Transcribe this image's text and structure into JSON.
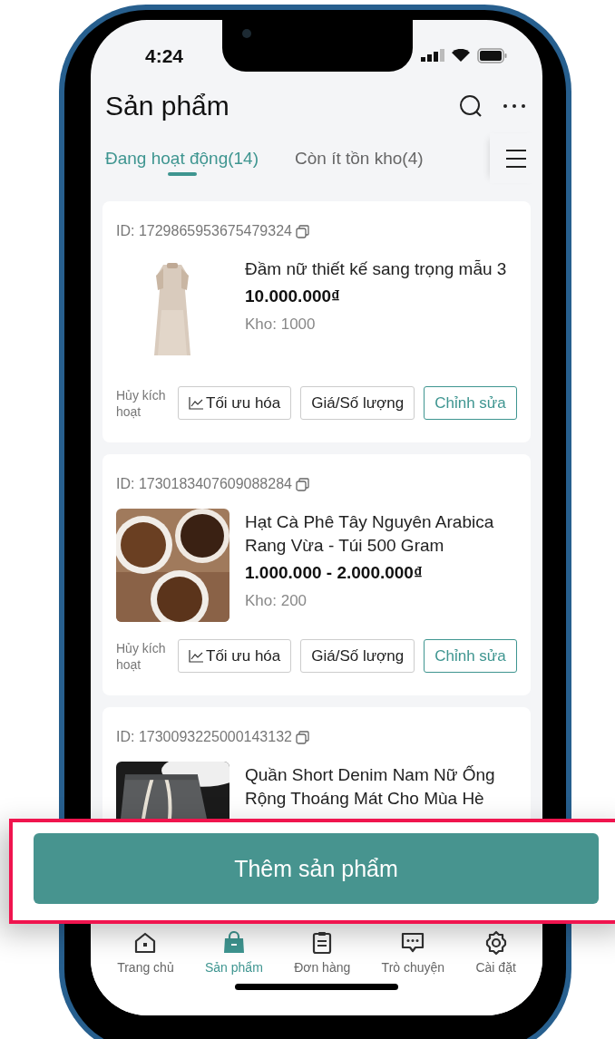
{
  "status_bar": {
    "time": "4:24"
  },
  "header": {
    "title": "Sản phẩm"
  },
  "tabs": [
    {
      "label": "Đang hoạt động(14)",
      "selected": true
    },
    {
      "label": "Còn ít tồn kho(4)",
      "selected": false
    }
  ],
  "products": [
    {
      "id": "ID: 1729865953675479324",
      "name": "Đầm nữ thiết kế sang trọng mẫu 3",
      "price": "10.000.000₫",
      "stock": "Kho: 1000",
      "deactivate": "Hủy kích hoạt",
      "actions": [
        {
          "label": "Tối ưu hóa",
          "kind": "icon"
        },
        {
          "label": "Giá/Số lượng",
          "kind": "plain"
        },
        {
          "label": "Chỉnh sửa",
          "kind": "accent"
        }
      ]
    },
    {
      "id": "ID: 1730183407609088284",
      "name": "Hạt Cà Phê Tây Nguyên Arabica Rang Vừa - Túi 500 Gram",
      "price": "1.000.000 - 2.000.000₫",
      "stock": "Kho: 200",
      "deactivate": "Hủy kích hoạt",
      "actions": [
        {
          "label": "Tối ưu hóa",
          "kind": "icon"
        },
        {
          "label": "Giá/Số lượng",
          "kind": "plain"
        },
        {
          "label": "Chỉnh sửa",
          "kind": "accent"
        }
      ]
    },
    {
      "id": "ID: 1730093225000143132",
      "name": "Quần Short Denim Nam Nữ Ống Rộng Thoáng Mát Cho Mùa Hè"
    }
  ],
  "add_button": "Thêm sản phẩm",
  "nav": [
    {
      "label": "Trang chủ",
      "selected": false
    },
    {
      "label": "Sản phẩm",
      "selected": true
    },
    {
      "label": "Đơn hàng",
      "selected": false
    },
    {
      "label": "Trò chuyện",
      "selected": false
    },
    {
      "label": "Cài đặt",
      "selected": false
    }
  ]
}
